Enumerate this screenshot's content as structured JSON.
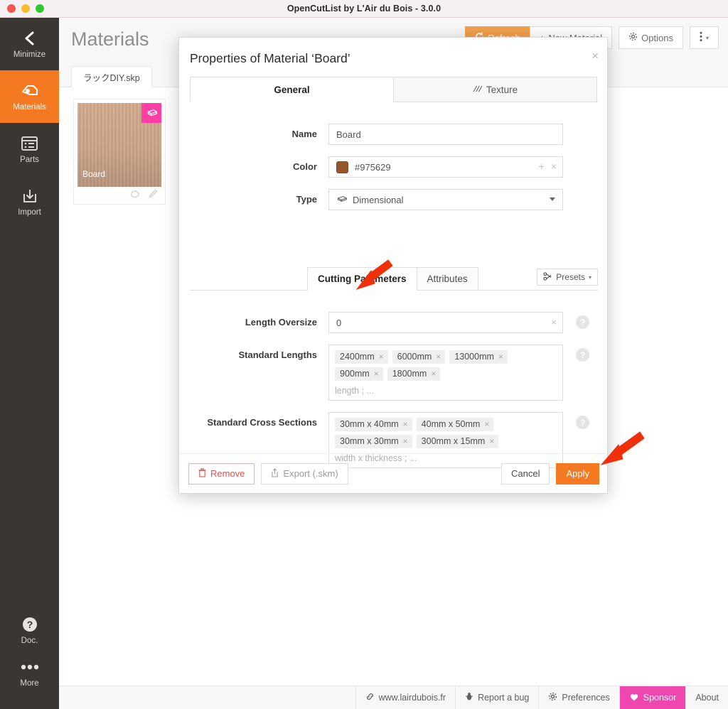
{
  "window": {
    "title": "OpenCutList by L'Air du Bois - 3.0.0",
    "traffic_lights": [
      "close",
      "minimize",
      "zoom"
    ]
  },
  "sidebar": {
    "items": [
      {
        "label": "Minimize",
        "icon": "chevron-left-icon",
        "active": false
      },
      {
        "label": "Materials",
        "icon": "materials-icon",
        "active": true
      },
      {
        "label": "Parts",
        "icon": "parts-list-icon",
        "active": false
      },
      {
        "label": "Import",
        "icon": "import-icon",
        "active": false
      }
    ],
    "bottom_items": [
      {
        "label": "Doc.",
        "icon": "question-circle-icon"
      },
      {
        "label": "More",
        "icon": "ellipsis-icon"
      }
    ]
  },
  "header": {
    "title": "Materials",
    "buttons": [
      {
        "label": "Refresh",
        "icon": "refresh-icon",
        "style": "primary"
      },
      {
        "label": "New Material",
        "icon": "plus-icon",
        "style": "default"
      },
      {
        "label": "Options",
        "icon": "gear-icon",
        "style": "default"
      },
      {
        "label": "",
        "icon": "vertical-dots-icon",
        "style": "default"
      }
    ]
  },
  "file_tab": {
    "label": "ラックDIY.skp"
  },
  "material_card": {
    "name": "Board",
    "badge_icon": "board-type-icon",
    "badge_color": "#ff3fa4",
    "tools": [
      "paint-bucket-icon",
      "pencil-icon"
    ]
  },
  "statusbar": {
    "items": [
      {
        "label": "www.lairdubois.fr",
        "icon": "link-icon",
        "highlight": false
      },
      {
        "label": "Report a bug",
        "icon": "bug-icon",
        "highlight": false
      },
      {
        "label": "Preferences",
        "icon": "gear-icon",
        "highlight": false
      },
      {
        "label": "Sponsor",
        "icon": "heart-icon",
        "highlight": true
      },
      {
        "label": "About",
        "icon": "",
        "highlight": false
      }
    ],
    "sponsor_color": "#ef46b0"
  },
  "dialog": {
    "title": "Properties of Material ‘Board’",
    "close_label": "×",
    "tabs": [
      {
        "label": "General",
        "icon": "",
        "active": true
      },
      {
        "label": "Texture",
        "icon": "hatch-icon",
        "active": false
      }
    ],
    "fields": {
      "name": {
        "label": "Name",
        "value": "Board"
      },
      "color": {
        "label": "Color",
        "value": "#975629",
        "swatch": "#975629",
        "add_icon": "plus-icon",
        "clear_icon": "close-icon"
      },
      "type": {
        "label": "Type",
        "value": "Dimensional",
        "icon": "board-type-icon"
      }
    },
    "subtabs": [
      {
        "label": "Cutting Parameters",
        "active": true
      },
      {
        "label": "Attributes",
        "active": false
      }
    ],
    "presets_button": {
      "label": "Presets",
      "icon": "presets-icon",
      "caret": "▾"
    },
    "cutting": {
      "length_oversize": {
        "label": "Length Oversize",
        "value": "0",
        "clear_icon": "×",
        "help": "?"
      },
      "standard_lengths": {
        "label": "Standard Lengths",
        "tags": [
          "2400mm",
          "6000mm",
          "13000mm",
          "900mm",
          "1800mm"
        ],
        "placeholder": "length ; ...",
        "help": "?"
      },
      "standard_cross_sections": {
        "label": "Standard Cross Sections",
        "tags": [
          "30mm x 40mm",
          "40mm x 50mm",
          "30mm x 30mm",
          "300mm x 15mm"
        ],
        "placeholder": "width x thickness ; ...",
        "help": "?"
      }
    },
    "footer": {
      "remove": {
        "label": "Remove",
        "icon": "trash-icon"
      },
      "export": {
        "label": "Export (.skm)",
        "icon": "export-icon"
      },
      "cancel": {
        "label": "Cancel"
      },
      "apply": {
        "label": "Apply",
        "color": "#f47920"
      }
    }
  },
  "annotations": {
    "arrows": [
      {
        "name": "arrow-length-oversize",
        "color": "#f0300a"
      },
      {
        "name": "arrow-apply-button",
        "color": "#f0300a"
      }
    ]
  }
}
